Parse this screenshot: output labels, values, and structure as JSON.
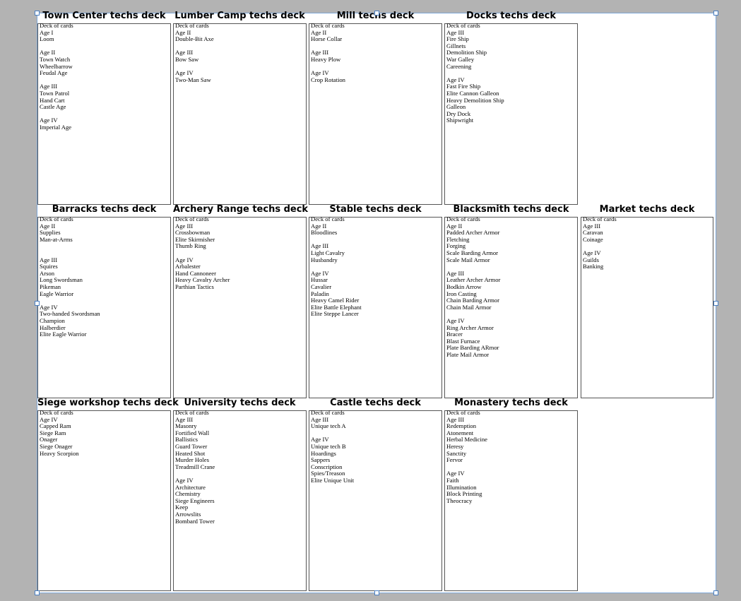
{
  "decks": [
    {
      "title": "Town Center techs deck",
      "lines": [
        "Deck of cards",
        "Age I",
        "Loom",
        "",
        "Age II",
        "Town Watch",
        "Wheelbarrow",
        "Feudal Age",
        "",
        "Age III",
        "Town Patrol",
        "Hand Cart",
        "Castle Age",
        "",
        "Age IV",
        "Imperial Age"
      ]
    },
    {
      "title": "Lumber Camp techs deck",
      "lines": [
        "Deck of cards",
        "Age II",
        "Double-Bit Axe",
        "",
        "Age III",
        "Bow Saw",
        "",
        "Age IV",
        "Two-Man Saw"
      ]
    },
    {
      "title": "Mill techs deck",
      "lines": [
        "Deck of cards",
        "Age II",
        "Horse Collar",
        "",
        "Age III",
        "Heavy Plow",
        "",
        "Age IV",
        "Crop Rotation"
      ]
    },
    {
      "title": "Docks techs deck",
      "lines": [
        "Deck of cards",
        "Age III",
        "Fire Ship",
        "Gillnets",
        "Demolition Ship",
        "War Galley",
        "Careening",
        "",
        "Age IV",
        "Fast Fire Ship",
        "Elite Cannon Galleon",
        "Heavy Demolition Ship",
        "Galleon",
        "Dry Dock",
        "Shipwright"
      ]
    },
    {
      "title": "Barracks techs deck",
      "lines": [
        "Deck of cards",
        "Age II",
        "Supplies",
        "Man-at-Arms",
        "",
        "",
        "Age III",
        "Squires",
        "Arson",
        "Long Swordsman",
        "Pikeman",
        "Eagle Warrior",
        "",
        "Age IV",
        "Two-handed Swordsman",
        "Champion",
        "Halberdier",
        "Elite Eagle Warrior"
      ]
    },
    {
      "title": "Archery Range techs deck",
      "lines": [
        "Deck of cards",
        "Age III",
        "Crossbowman",
        "Elite Skirmisher",
        "Thumb Ring",
        "",
        "Age IV",
        "Arbalester",
        "Hand Cannoneer",
        "Heavy Cavalry Archer",
        "Parthian Tactics"
      ]
    },
    {
      "title": "Stable techs deck",
      "lines": [
        "Deck of cards",
        "Age II",
        "Bloodlines",
        "",
        "Age III",
        "Light Cavalry",
        "Husbandry",
        "",
        "Age IV",
        "Hussar",
        "Cavalier",
        "Paladin",
        "Heavy Camel Rider",
        "Elite Battle Elephant",
        "Elite Steppe Lancer"
      ]
    },
    {
      "title": "Blacksmith techs deck",
      "lines": [
        "Deck of cards",
        "Age II",
        "Padded Archer Armor",
        "Fletching",
        "Forging",
        "Scale Barding Armor",
        "Scale Mail Armor",
        "",
        "Age III",
        "Leather Archer Armor",
        "Bodkin Arrow",
        "Iron Casting",
        "Chain Barding Armor",
        "Chain Mail Armor",
        "",
        "Age IV",
        "Ring Archer Armor",
        "Bracer",
        "Blast Furnace",
        "Plate Barding ARmor",
        "Plate Mail Armor"
      ]
    },
    {
      "title": "Market techs deck",
      "lines": [
        "Deck of cards",
        "Age III",
        "Caravan",
        "Coinage",
        "",
        "Age IV",
        "Guilds",
        "Banking"
      ]
    },
    {
      "title": "Siege workshop techs deck",
      "lines": [
        "Deck of cards",
        "Age IV",
        "Capped Ram",
        "Siege Ram",
        "Onager",
        "Siege Onager",
        "Heavy Scorpion"
      ]
    },
    {
      "title": "University techs deck",
      "lines": [
        "Deck of cards",
        "Age III",
        "Masonry",
        "Fortified Wall",
        "Ballistics",
        "Guard Tower",
        "Heated Shot",
        "Murder Holes",
        "Treadmill Crane",
        "",
        "Age IV",
        "Architecture",
        "Chemistry",
        "Siege Engineers",
        "Keep",
        "Arrowslits",
        "Bombard Tower"
      ]
    },
    {
      "title": "Castle techs deck",
      "lines": [
        "Deck of cards",
        "Age III",
        "Unique tech A",
        "",
        "Age IV",
        "Unique tech B",
        "Hoardings",
        "Sappers",
        "Conscription",
        "Spies/Treason",
        "Elite Unique Unit"
      ]
    },
    {
      "title": "Monastery techs deck",
      "lines": [
        "Deck of cards",
        "Age III",
        "Redemption",
        "Atonement",
        "Herbal Medicine",
        "Heresy",
        "Sanctity",
        "Fervor",
        "",
        "Age IV",
        "Faith",
        "Illumination",
        "Block Printing",
        "Theocracy"
      ]
    }
  ]
}
